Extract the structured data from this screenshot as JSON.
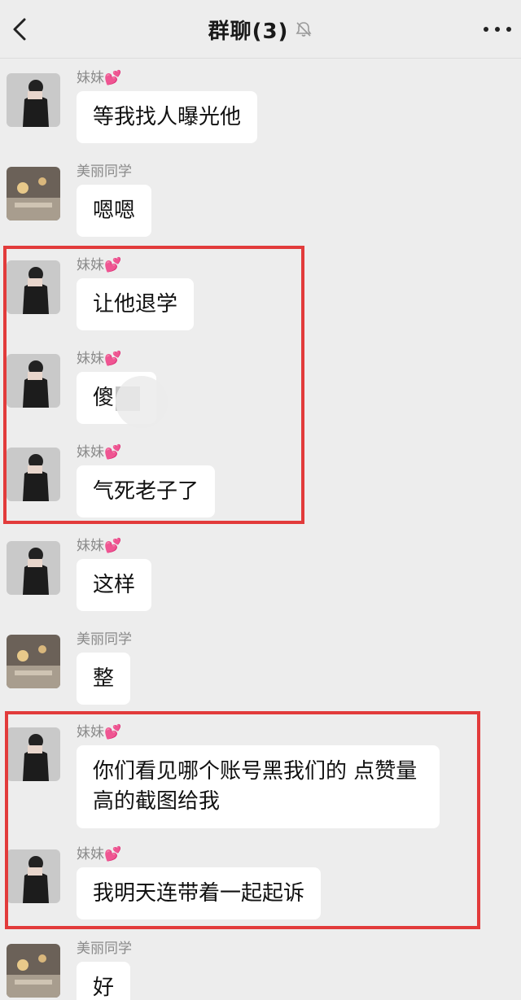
{
  "header": {
    "title": "群聊(3)",
    "muted_icon": "bell-off-icon",
    "back_icon": "chevron-left-icon",
    "more_icon": "more-dots-icon"
  },
  "colors": {
    "background": "#ededed",
    "bubble": "#ffffff",
    "highlight": "#e23b3b",
    "sender_name": "#8a8a8a",
    "heart": "#e0408a"
  },
  "messages": [
    {
      "sender": "妹妹",
      "heart": "💕",
      "avatar": "girl-avatar",
      "text": "等我找人曝光他"
    },
    {
      "sender": "美丽同学",
      "heart": "",
      "avatar": "room-avatar",
      "text": "嗯嗯"
    },
    {
      "sender": "妹妹",
      "heart": "💕",
      "avatar": "girl-avatar",
      "text": "让他退学"
    },
    {
      "sender": "妹妹",
      "heart": "💕",
      "avatar": "girl-avatar",
      "text": "傻"
    },
    {
      "sender": "妹妹",
      "heart": "💕",
      "avatar": "girl-avatar",
      "text": "气死老子了"
    },
    {
      "sender": "妹妹",
      "heart": "💕",
      "avatar": "girl-avatar",
      "text": "这样"
    },
    {
      "sender": "美丽同学",
      "heart": "",
      "avatar": "room-avatar",
      "text": "整"
    },
    {
      "sender": "妹妹",
      "heart": "💕",
      "avatar": "girl-avatar",
      "text": "你们看见哪个账号黑我们的 点赞量高的截图给我"
    },
    {
      "sender": "妹妹",
      "heart": "💕",
      "avatar": "girl-avatar",
      "text": "我明天连带着一起起诉"
    },
    {
      "sender": "美丽同学",
      "heart": "",
      "avatar": "room-avatar",
      "text": "好"
    }
  ]
}
